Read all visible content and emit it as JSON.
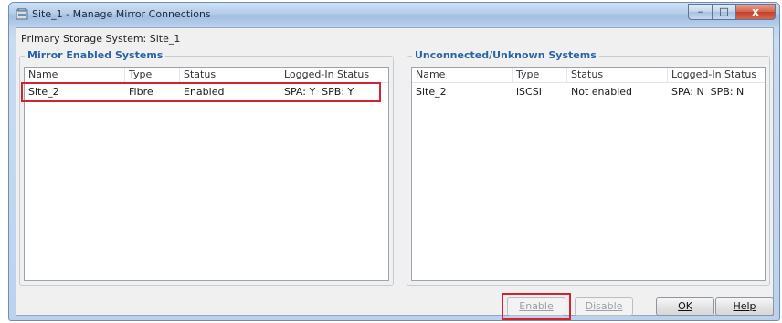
{
  "window": {
    "title": "Site_1 - Manage Mirror Connections",
    "caption": {
      "minimize": "–",
      "maximize": "□",
      "close": "x"
    }
  },
  "primary_storage_label": "Primary Storage System: Site_1",
  "mirror_enabled": {
    "title": "Mirror Enabled Systems",
    "columns": [
      "Name",
      "Type",
      "Status",
      "Logged-In Status"
    ],
    "rows": [
      {
        "name": "Site_2",
        "type": "Fibre",
        "status": "Enabled",
        "logged_in": "SPA: Y  SPB: Y"
      }
    ]
  },
  "unconnected": {
    "title": "Unconnected/Unknown Systems",
    "columns": [
      "Name",
      "Type",
      "Status",
      "Logged-In Status"
    ],
    "rows": [
      {
        "name": "Site_2",
        "type": "iSCSI",
        "status": "Not enabled",
        "logged_in": "SPA: N  SPB: N"
      }
    ]
  },
  "buttons": {
    "enable": "Enable",
    "disable": "Disable",
    "ok": "OK",
    "help": "Help"
  },
  "colors": {
    "highlight": "#d42330",
    "group_title": "#2a62a6"
  }
}
